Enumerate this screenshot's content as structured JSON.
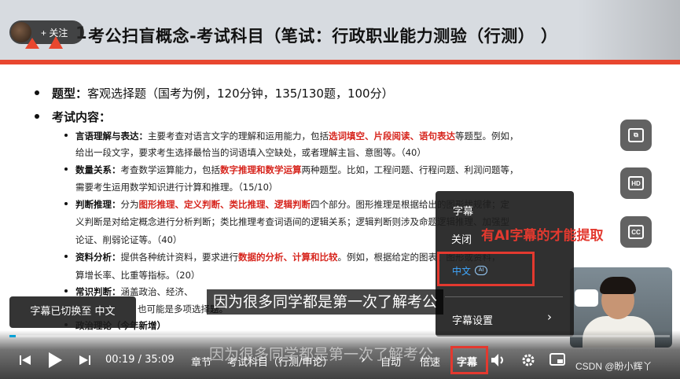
{
  "slide": {
    "title_num": "1",
    "title": "考公扫盲概念-考试科目（笔试：行政职业能力测验（行测）  ）",
    "bullet1_label": "题型：",
    "bullet1_text": "客观选择题（国考为例，120分钟，135/130题，100分）",
    "bullet2_label": "考试内容：",
    "items": [
      {
        "label": "言语理解与表达：",
        "text_a": "主要考查对语言文字的理解和运用能力，包括",
        "red": "选词填空、片段阅读、语句表达",
        "text_b": "等题型。例如，",
        "line2": "给出一段文字，要求考生选择最恰当的词语填入空缺处，或者理解主旨、意图等。（40）"
      },
      {
        "label": "数量关系：",
        "text_a": "考查数学运算能力，包括",
        "red": "数字推理和数学运算",
        "text_b": "两种题型。比如，工程问题、行程问题、利润问题等，",
        "line2": "需要考生运用数学知识进行计算和推理。（15/10）"
      },
      {
        "label": "判断推理：",
        "text_a": "分为",
        "red": "图形推理、定义判断、类比推理、逻辑判断",
        "text_b": "四个部分。图形推理是根据给出的图形找规律；定",
        "line2": "义判断是对给定概念进行分析判断；类比推理考查词语间的逻辑关系；逻辑判断则涉及命题逻辑推理、加强型",
        "line3": "论证、削弱论证等。（40）"
      },
      {
        "label": "资料分析：",
        "text_a": "提供各种统计资料，要求进行",
        "red": "数据的分析、计算和比较",
        "text_b": "。例如，根据给定的图表、图形或资料，",
        "line2": "算增长率、比重等指标。（20）"
      },
      {
        "label": "常识判断：",
        "text_a": "涵盖政治、经济、",
        "red": "",
        "text_b": "",
        "line2": "也可能是多项选择题。"
      }
    ],
    "item6": "政治理论（今年新增）"
  },
  "follow_button": "关注",
  "follow_plus": "+",
  "side_icons": [
    "picture-in-picture-icon",
    "hd-icon",
    "cc-icon"
  ],
  "side_icon_glyphs": [
    "⧉",
    "HD",
    "CC"
  ],
  "subtitle_menu": {
    "title": "字幕",
    "off": "关闭",
    "chinese": "中文",
    "ai_badge": "AI",
    "settings": "字幕设置",
    "settings_arrow": "›"
  },
  "annotation": "有AI字幕的才能提取",
  "toast": "字幕已切换至 中文",
  "caption": "因为很多同学都是第一次了解考公",
  "caption_echo": "因为很多同学都是第一次了解考公",
  "controls": {
    "current_time": "00:19",
    "separator": "/",
    "duration": "35:09",
    "progress_fraction": 0.009,
    "chapter": "章节",
    "chapter_title": "考试科目（行测/申论）",
    "chapter_arrow": "›",
    "autoplay": "自动",
    "speed": "倍速",
    "subtitle": "字幕"
  },
  "csdn_watermark": "CSDN @盼小辉丫",
  "colors": {
    "accent_red": "#e3392f",
    "title_bar_red": "#e8472f",
    "link_blue": "#40a8ff",
    "progress": "#00a1d6"
  }
}
